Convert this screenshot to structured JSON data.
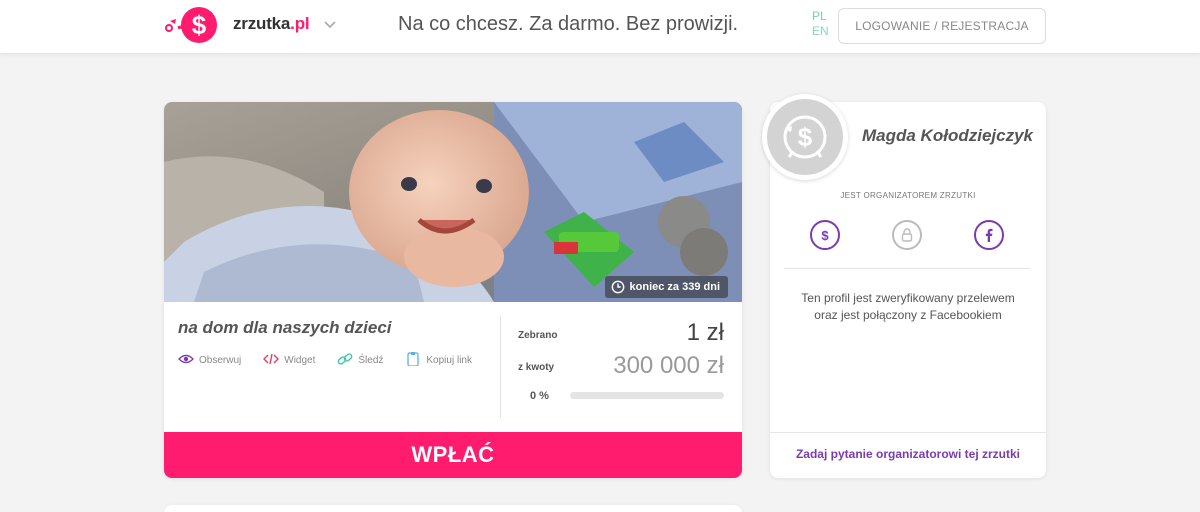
{
  "header": {
    "logo_name": "zrzutka",
    "logo_tld": ".pl",
    "tagline": "Na co chcesz. Za darmo. Bez prowizji.",
    "lang_active": "PL",
    "lang_other": "EN",
    "login_label": "LOGOWANIE / REJESTRACJA"
  },
  "campaign": {
    "ends_in": "koniec za 339 dni",
    "title": "na dom dla naszych dzieci",
    "actions": {
      "follow": "Obserwuj",
      "widget": "Widget",
      "track": "Śledź",
      "copy_link": "Kopiuj link"
    },
    "collected_label": "Zebrano",
    "collected_value": "1 zł",
    "goal_label": "z kwoty",
    "goal_value": "300 000 zł",
    "percent_label": "0 %",
    "progress_fraction": 0.0,
    "pay_label": "WPŁAĆ"
  },
  "organizer": {
    "name": "Magda Kołodziejczyk",
    "role": "JEST ORGANIZATOREM ZRZUTKI",
    "verified_text": "Ten profil jest zweryfikowany przelewem oraz jest połączony z Facebookiem",
    "question_link": "Zadaj pytanie organizatorowi tej zrzutki"
  },
  "colors": {
    "brand_pink": "#ff1b6d",
    "accent_purple": "#7a3bb0",
    "lang_green": "#6dd3b6"
  }
}
